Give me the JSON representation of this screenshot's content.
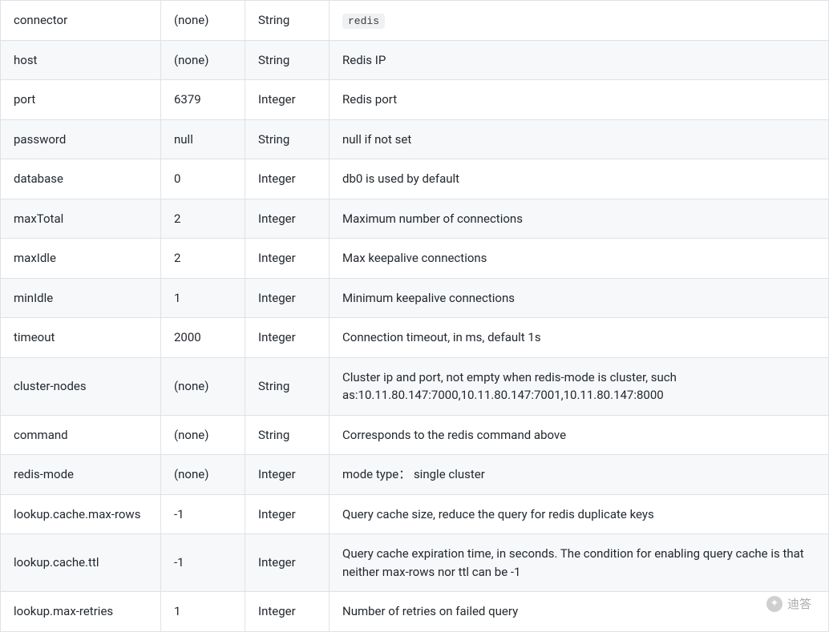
{
  "table": {
    "rows": [
      {
        "name": "connector",
        "default": "(none)",
        "type": "String",
        "desc": "redis",
        "desc_is_code": true
      },
      {
        "name": "host",
        "default": "(none)",
        "type": "String",
        "desc": "Redis IP"
      },
      {
        "name": "port",
        "default": "6379",
        "type": "Integer",
        "desc": "Redis port"
      },
      {
        "name": "password",
        "default": "null",
        "type": "String",
        "desc": "null if not set"
      },
      {
        "name": "database",
        "default": "0",
        "type": "Integer",
        "desc": "db0 is used by default"
      },
      {
        "name": "maxTotal",
        "default": "2",
        "type": "Integer",
        "desc": "Maximum number of connections"
      },
      {
        "name": "maxIdle",
        "default": "2",
        "type": "Integer",
        "desc": "Max keepalive connections"
      },
      {
        "name": "minIdle",
        "default": "1",
        "type": "Integer",
        "desc": "Minimum keepalive connections"
      },
      {
        "name": "timeout",
        "default": "2000",
        "type": "Integer",
        "desc": "Connection timeout, in ms, default 1s"
      },
      {
        "name": "cluster-nodes",
        "default": "(none)",
        "type": "String",
        "desc": "Cluster ip and port, not empty when redis-mode is cluster, such as:10.11.80.147:7000,10.11.80.147:7001,10.11.80.147:8000"
      },
      {
        "name": "command",
        "default": "(none)",
        "type": "String",
        "desc": "Corresponds to the redis command above"
      },
      {
        "name": "redis-mode",
        "default": "(none)",
        "type": "Integer",
        "desc": "mode type： single cluster"
      },
      {
        "name": "lookup.cache.max-rows",
        "default": "-1",
        "type": "Integer",
        "desc": "Query cache size, reduce the query for redis duplicate keys"
      },
      {
        "name": "lookup.cache.ttl",
        "default": "-1",
        "type": "Integer",
        "desc": "Query cache expiration time, in seconds. The condition for enabling query cache is that neither max-rows nor ttl can be -1"
      },
      {
        "name": "lookup.max-retries",
        "default": "1",
        "type": "Integer",
        "desc": "Number of retries on failed query"
      }
    ]
  },
  "watermark": {
    "text": "迪答"
  }
}
